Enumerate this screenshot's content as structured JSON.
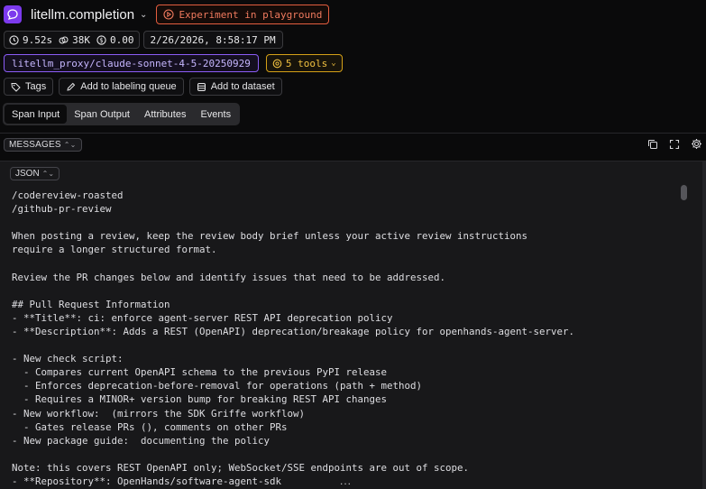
{
  "header": {
    "title": "litellm.completion",
    "experiment_label": "Experiment in playground"
  },
  "stats": {
    "latency": "9.52s",
    "tokens": "38K",
    "cost": "0.00",
    "timestamp": "2/26/2026, 8:58:17 PM"
  },
  "model": {
    "name": "litellm_proxy/claude-sonnet-4-5-20250929",
    "tools_label": "5 tools"
  },
  "actions": {
    "tags": "Tags",
    "labeling": "Add to labeling queue",
    "dataset": "Add to dataset"
  },
  "tabs": [
    "Span Input",
    "Span Output",
    "Attributes",
    "Events"
  ],
  "messages_label": "MESSAGES",
  "json_label": "JSON",
  "code_lines": [
    "/codereview-roasted",
    "/github-pr-review",
    "",
    "When posting a review, keep the review body brief unless your active review instructions",
    "require a longer structured format.",
    "",
    "Review the PR changes below and identify issues that need to be addressed.",
    "",
    "## Pull Request Information",
    "- **Title**: ci: enforce agent-server REST API deprecation policy",
    "- **Description**: Adds a REST (OpenAPI) deprecation/breakage policy for openhands-agent-server.",
    "",
    "- New check script:",
    "  - Compares current OpenAPI schema to the previous PyPI release",
    "  - Enforces deprecation-before-removal for operations (path + method)",
    "  - Requires a MINOR+ version bump for breaking REST API changes",
    "- New workflow:  (mirrors the SDK Griffe workflow)",
    "  - Gates release PRs (), comments on other PRs",
    "- New package guide:  documenting the policy",
    "",
    "Note: this covers REST OpenAPI only; WebSocket/SSE endpoints are out of scope.",
    "- **Repository**: OpenHands/software-agent-sdk"
  ],
  "more_indicator": "..."
}
